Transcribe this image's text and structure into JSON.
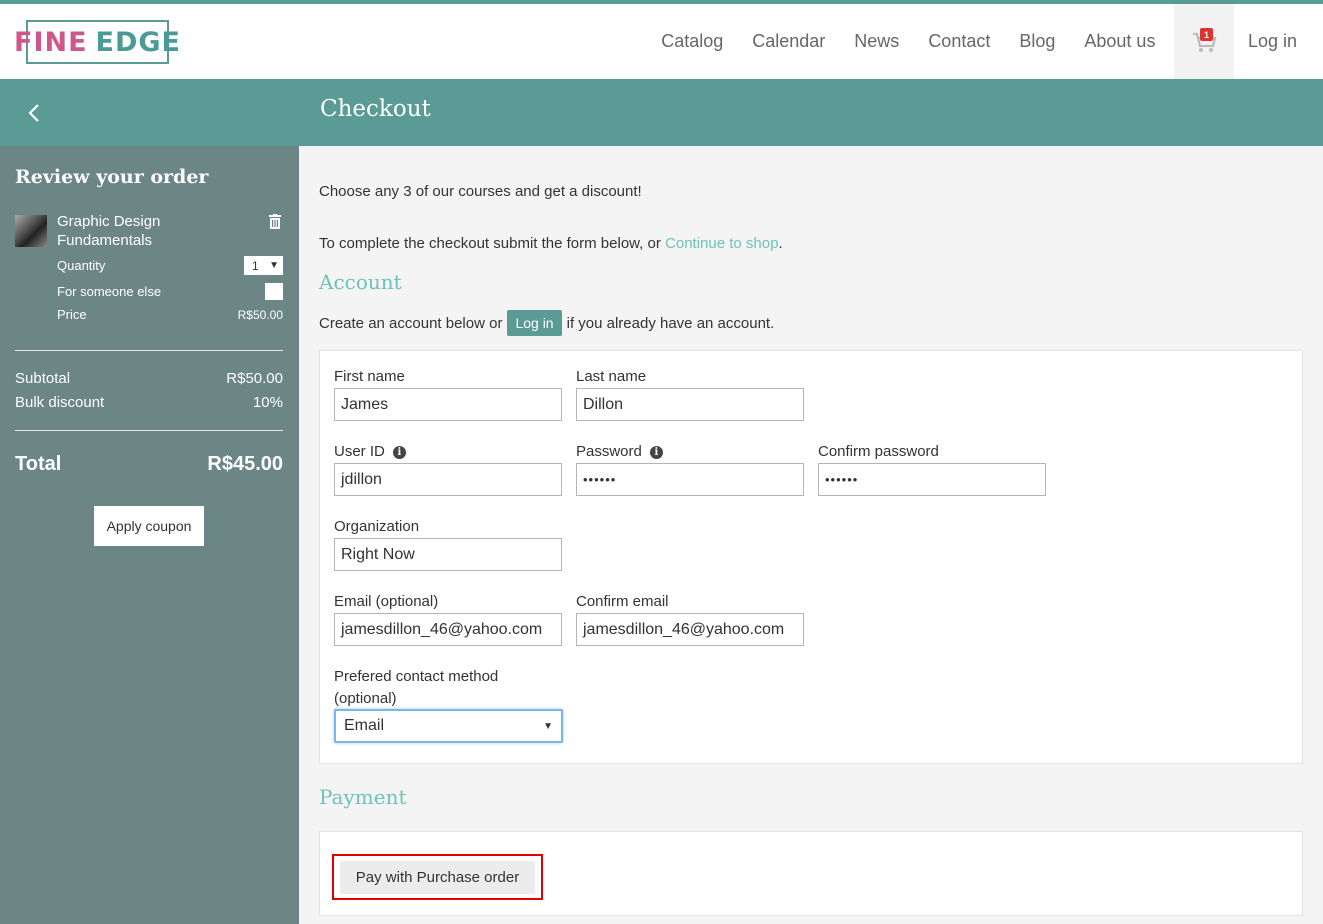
{
  "header": {
    "logo_part1": "FINE",
    "logo_part2": "EDGE",
    "nav": [
      "Catalog",
      "Calendar",
      "News",
      "Contact",
      "Blog",
      "About us"
    ],
    "cart_count": "1",
    "login": "Log in"
  },
  "page": {
    "title": "Checkout"
  },
  "sidebar": {
    "title": "Review your order",
    "item_name": "Graphic Design Fundamentals",
    "quantity_label": "Quantity",
    "quantity_value": "1",
    "someone_else_label": "For someone else",
    "price_label": "Price",
    "price_value": "R$50.00",
    "subtotal_label": "Subtotal",
    "subtotal_value": "R$50.00",
    "discount_label": "Bulk discount",
    "discount_value": "10%",
    "total_label": "Total",
    "total_value": "R$45.00",
    "coupon_button": "Apply coupon"
  },
  "main": {
    "promo": "Choose any 3 of our courses and get a discount!",
    "instructions_pre": "To complete the checkout submit the form below, or ",
    "continue_link": "Continue to shop",
    "instructions_post": ".",
    "account_heading": "Account",
    "account_pre": "Create an account below or",
    "account_login": "Log in",
    "account_post": "if you already have an account.",
    "fields": {
      "first_name_label": "First name",
      "first_name_value": "James",
      "last_name_label": "Last name",
      "last_name_value": "Dillon",
      "user_id_label": "User ID",
      "user_id_value": "jdillon",
      "password_label": "Password",
      "password_value": "••••••",
      "confirm_password_label": "Confirm password",
      "confirm_password_value": "••••••",
      "organization_label": "Organization",
      "organization_value": "Right Now",
      "email_label": "Email (optional)",
      "email_value": "jamesdillon_46@yahoo.com",
      "confirm_email_label": "Confirm email",
      "confirm_email_value": "jamesdillon_46@yahoo.com",
      "contact_method_label": "Prefered contact method (optional)",
      "contact_method_value": "Email"
    },
    "payment_heading": "Payment",
    "pay_button": "Pay with Purchase order"
  },
  "colors": {
    "teal": "#5a9b96",
    "link_teal": "#6ec2b8",
    "sidebar": "#6b8685",
    "logo_pink": "#d0578a",
    "highlight_red": "#e00000"
  }
}
